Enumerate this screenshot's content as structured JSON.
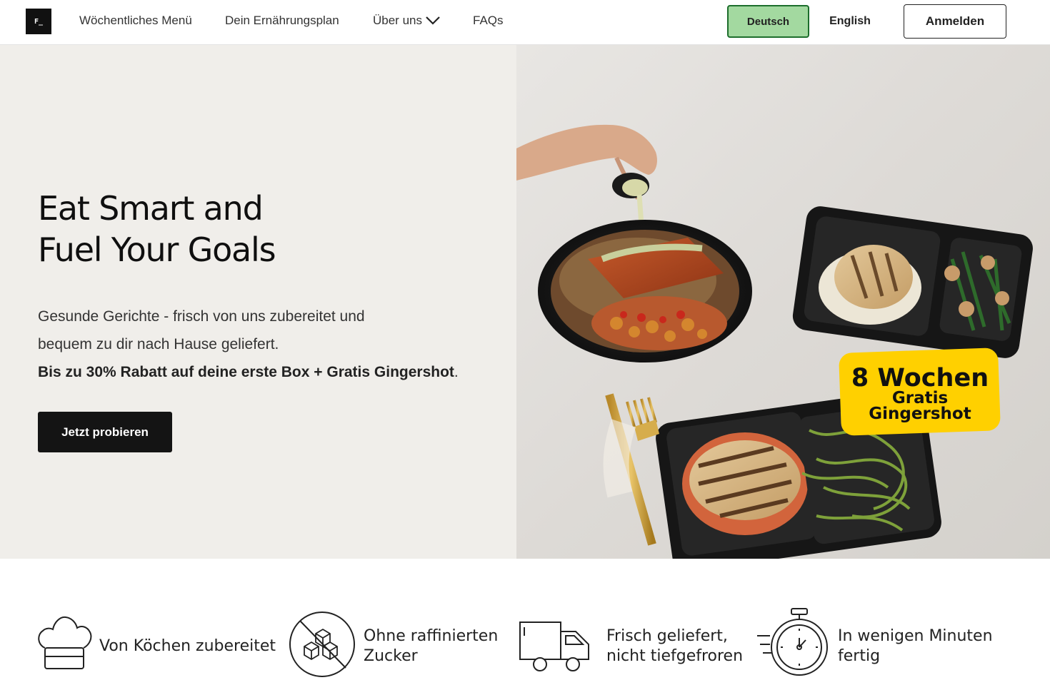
{
  "nav": {
    "logo": "F_",
    "links": [
      "Wöchentliches Menü",
      "Dein Ernährungsplan",
      "Über uns",
      "FAQs"
    ],
    "lang_de": "Deutsch",
    "lang_en": "English",
    "login": "Anmelden"
  },
  "hero": {
    "title_lines": [
      "Eat Smart and",
      "Fuel Your Goals"
    ],
    "desc_lines": [
      "Gesunde Gerichte - frisch von uns zubereitet und",
      "bequem zu dir nach Hause geliefert."
    ],
    "promo": "Bis zu 30% Rabatt auf deine erste Box + Gratis Gingershot",
    "promo_end": ".",
    "cta": "Jetzt probieren",
    "badge": {
      "line1": "8 Wochen",
      "line2": "Gratis",
      "line3": "Gingershot",
      "color": "#ffd000"
    }
  },
  "features": [
    {
      "icon": "chef-hat-icon",
      "lines": [
        "Von Köchen zubereitet"
      ]
    },
    {
      "icon": "no-sugar-icon",
      "lines": [
        "Ohne raffinierten",
        "Zucker"
      ]
    },
    {
      "icon": "delivery-truck-icon",
      "lines": [
        "Frisch geliefert,",
        "nicht tiefgefroren"
      ]
    },
    {
      "icon": "stopwatch-icon",
      "lines": [
        "In wenigen Minuten",
        "fertig"
      ]
    }
  ],
  "colors": {
    "accent_green": "#a3d9a0",
    "accent_green_border": "#1d6e2c",
    "hero_bg": "#f0eeea",
    "cta_bg": "#141414"
  }
}
